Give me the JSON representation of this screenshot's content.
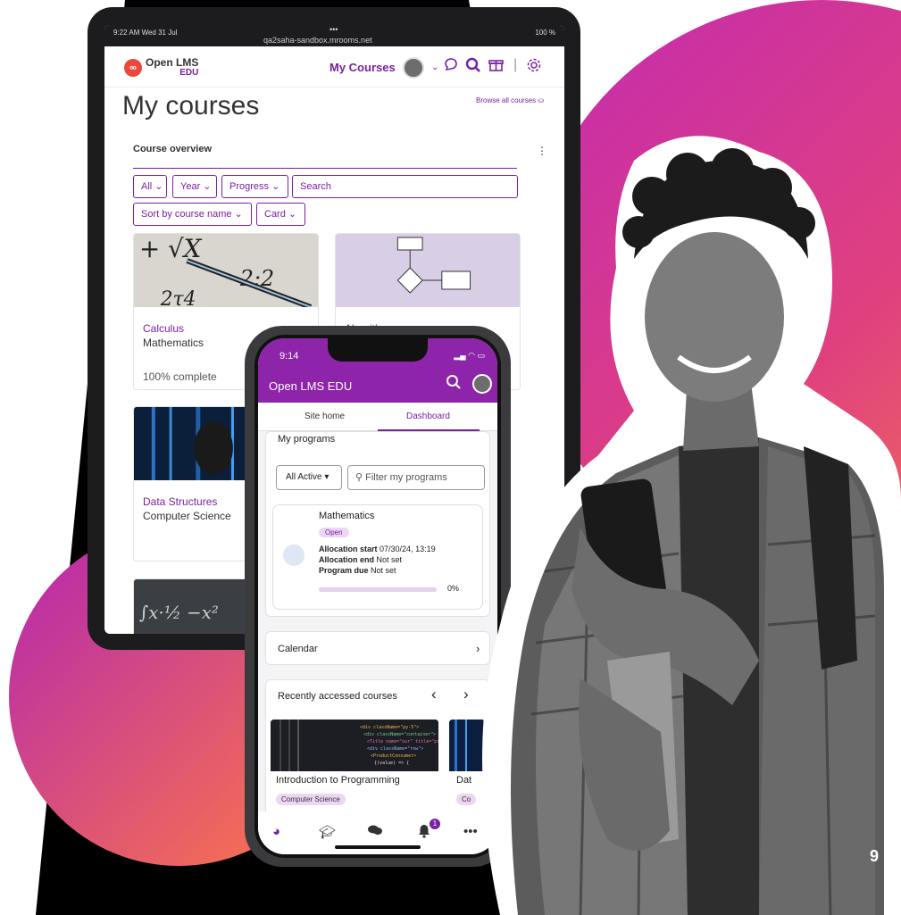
{
  "page_number": "9",
  "tablet": {
    "status": {
      "time": "9:22 AM  Wed 31 Jul",
      "dots": "•••",
      "url": "qa2saha-sandbox.mrooms.net",
      "battery": "100 %"
    },
    "logo": {
      "name": "Open LMS",
      "sub": "EDU"
    },
    "nav": {
      "my_courses": "My Courses"
    },
    "title": "My courses",
    "browse_all": "Browse all courses",
    "overview": {
      "heading": "Course overview",
      "menu": "⋮"
    },
    "filters": [
      "All",
      "Year",
      "Progress"
    ],
    "search": "Search",
    "sort": "Sort by course name",
    "view": "Card",
    "courses": [
      {
        "title": "Calculus",
        "category": "Mathematics",
        "progress": "100% complete"
      },
      {
        "title": "Algorithms",
        "category": "",
        "progress": ""
      },
      {
        "title": "Data Structures",
        "category": "Computer Science",
        "progress": ""
      }
    ]
  },
  "phone": {
    "time": "9:14",
    "brand": "Open LMS EDU",
    "tabs": [
      "Site home",
      "Dashboard"
    ],
    "active_tab": "Dashboard",
    "programs": {
      "heading": "My programs",
      "filter_select": "All Active",
      "filter_placeholder": "Filter my programs",
      "card": {
        "title": "Mathematics",
        "status": "Open",
        "allocation_start_label": "Allocation start",
        "allocation_start": "07/30/24, 13:19",
        "allocation_end_label": "Allocation end",
        "allocation_end": "Not set",
        "program_due_label": "Program due",
        "program_due": "Not set",
        "progress": "0%"
      }
    },
    "calendar": "Calendar",
    "recent": {
      "heading": "Recently accessed courses",
      "courses": [
        {
          "title": "Introduction to Programming",
          "category": "Computer Science"
        },
        {
          "title": "Dat",
          "category": "Co"
        }
      ]
    },
    "notification_count": "1"
  },
  "colors": {
    "brand_purple": "#7a1fa2",
    "header_purple": "#8e24aa",
    "accent_pink": "#d63aa0",
    "accent_orange": "#f28a40"
  }
}
